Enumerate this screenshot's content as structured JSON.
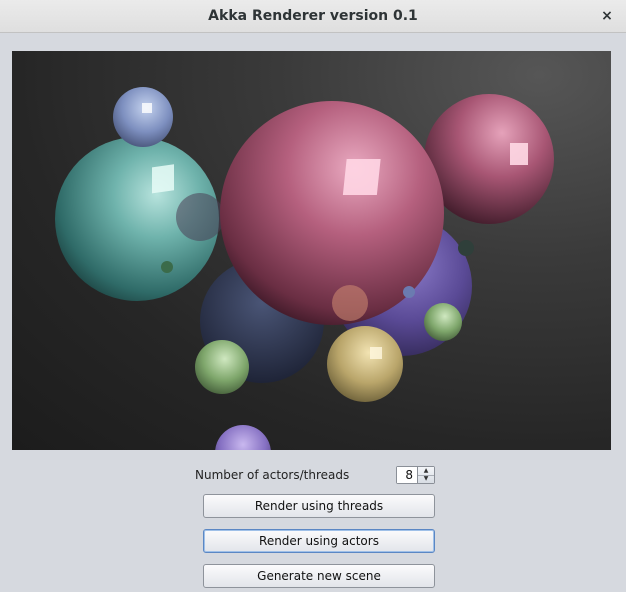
{
  "window": {
    "title": "Akka Renderer version 0.1",
    "close_icon": "close-icon"
  },
  "controls": {
    "actors_label": "Number of actors/threads",
    "actors_value": "8",
    "spinner_up": "▲",
    "spinner_down": "▼",
    "render_threads_label": "Render using threads",
    "render_actors_label": "Render using actors",
    "generate_scene_label": "Generate new scene"
  },
  "colors": {
    "window_bg": "#d6d9df",
    "canvas_bg": "#262626",
    "focus_border": "#5b87c4"
  },
  "close_glyph": "×"
}
